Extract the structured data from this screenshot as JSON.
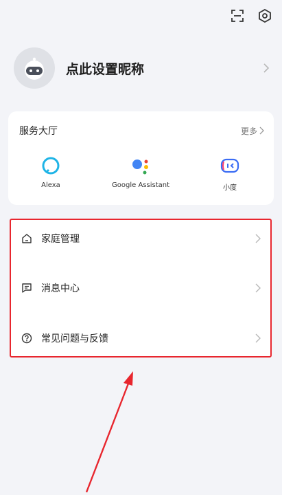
{
  "top_icons": [
    "scan-icon",
    "settings-icon"
  ],
  "profile": {
    "nickname": "点此设置昵称"
  },
  "services": {
    "title": "服务大厅",
    "more_label": "更多",
    "items": [
      {
        "label": "Alexa",
        "icon": "alexa-icon"
      },
      {
        "label": "Google Assistant",
        "icon": "google-assistant-icon"
      },
      {
        "label": "小度",
        "icon": "xiaodu-icon"
      }
    ]
  },
  "menu": {
    "items": [
      {
        "label": "家庭管理",
        "icon": "home-icon"
      },
      {
        "label": "消息中心",
        "icon": "message-icon"
      },
      {
        "label": "常见问题与反馈",
        "icon": "help-icon"
      }
    ]
  },
  "annotation": {
    "highlight_color": "#e8262e"
  }
}
